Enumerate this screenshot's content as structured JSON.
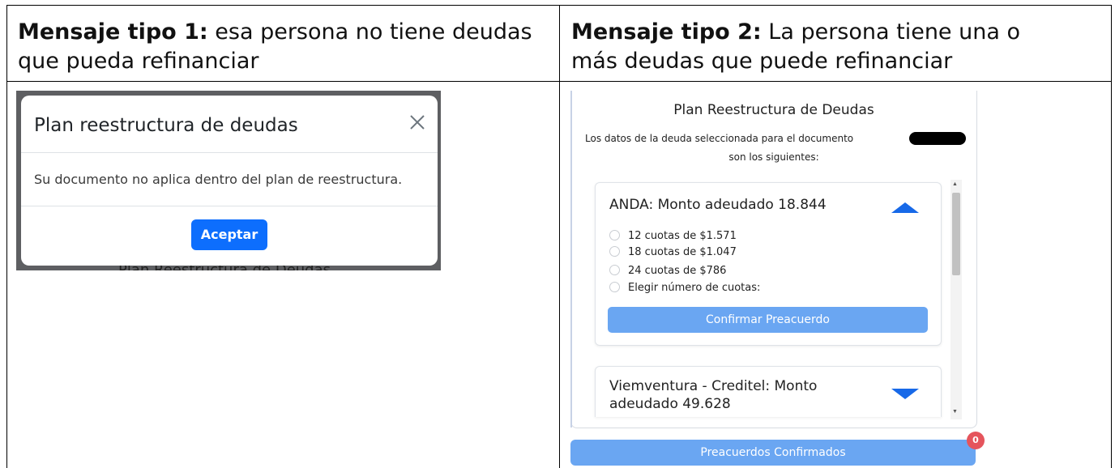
{
  "table": {
    "col1_header": {
      "bold": "Mensaje tipo 1:",
      "text": " esa persona no tiene deudas que pueda refinanciar"
    },
    "col2_header": {
      "bold": "Mensaje tipo 2:",
      "text": " La persona tiene una o más deudas que puede refinanciar"
    }
  },
  "modal": {
    "title": "Plan reestructura de deudas",
    "body": "Su documento no aplica dentro del plan de reestructura.",
    "accept_label": "Aceptar",
    "background_text": "Plan Reestructura de Deudas"
  },
  "panel": {
    "title": "Plan Reestructura de Deudas",
    "desc_line1": "Los datos de la deuda seleccionada para el documento",
    "desc_line2": "son los siguientes:",
    "debts": [
      {
        "title": "ANDA: Monto adeudado 18.844",
        "options": [
          "12 cuotas de $1.571",
          "18 cuotas de $1.047",
          "24 cuotas de $786",
          "Elegir número de cuotas:"
        ],
        "confirm_label": "Confirmar Preacuerdo"
      },
      {
        "title_line1": "Viemventura - Creditel: Monto",
        "title_line2": "adeudado 49.628"
      }
    ],
    "confirmed_label": "Preacuerdos Confirmados",
    "badge_count": "0"
  },
  "colors": {
    "primary": "#0d6efd",
    "light_primary": "#6aa6f2",
    "arrow": "#1769e8",
    "badge": "#e5545c",
    "overlay": "#5e5f62"
  }
}
